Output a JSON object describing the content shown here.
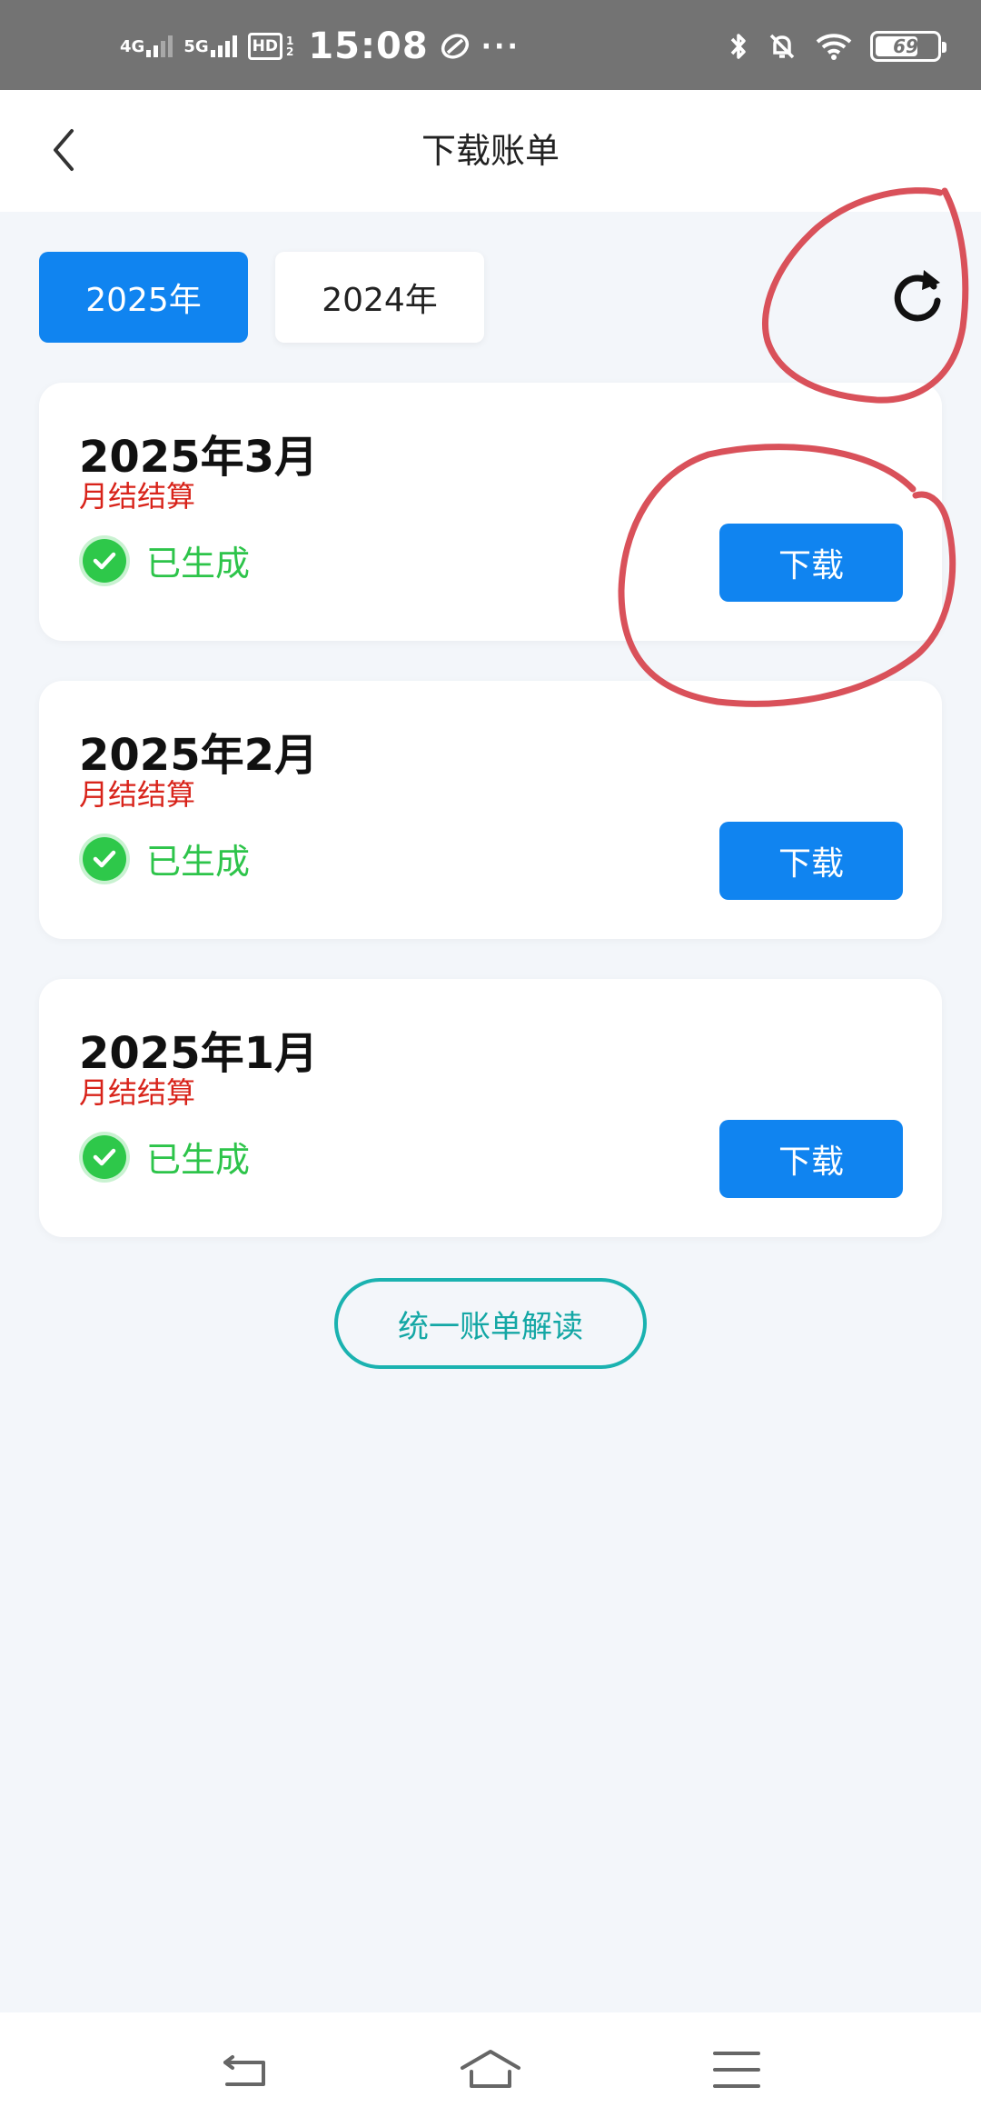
{
  "status_bar": {
    "net1_label": "4G",
    "net2_label": "5G",
    "hd_label": "HD",
    "hd_sub1": "1",
    "hd_sub2": "2",
    "time": "15:08",
    "dots": "···",
    "battery_level": "69",
    "icons": [
      "sim-signal-icon",
      "wechat-icon",
      "bluetooth-icon",
      "mute-bell-icon",
      "wifi-icon",
      "battery-icon"
    ]
  },
  "header": {
    "title": "下载账单",
    "back_icon": "chevron-left-icon"
  },
  "year_tabs": [
    {
      "label": "2025年",
      "selected": true
    },
    {
      "label": "2024年",
      "selected": false
    }
  ],
  "refresh_icon": "refresh-icon",
  "bills": [
    {
      "month": "2025年3月",
      "type": "月结结算",
      "status": "已生成",
      "button": "下载"
    },
    {
      "month": "2025年2月",
      "type": "月结结算",
      "status": "已生成",
      "button": "下载"
    },
    {
      "month": "2025年1月",
      "type": "月结结算",
      "status": "已生成",
      "button": "下载"
    }
  ],
  "explain_button": "统一账单解读",
  "nav_bar": {
    "icons": [
      "back-nav-icon",
      "home-nav-icon",
      "menu-nav-icon"
    ]
  },
  "colors": {
    "primary": "#1084f0",
    "success": "#2dc44a",
    "type_red": "#d8231a",
    "teal": "#1ab2b0",
    "annotation_red": "#d9515a",
    "background": "#f3f6fa"
  }
}
